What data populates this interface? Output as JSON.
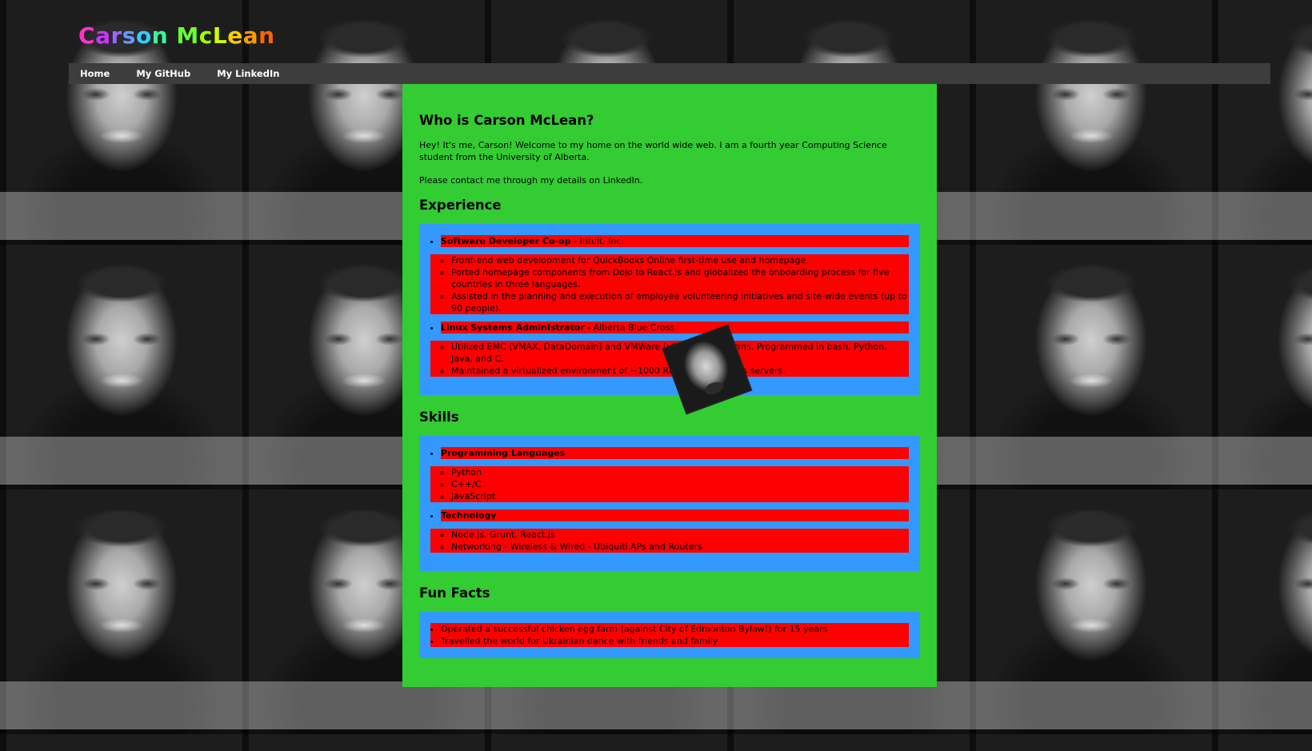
{
  "site": {
    "title_letters": [
      {
        "ch": "C",
        "color": "#ff33cc"
      },
      {
        "ch": "a",
        "color": "#cc33ff"
      },
      {
        "ch": "r",
        "color": "#9966ff"
      },
      {
        "ch": "s",
        "color": "#6699ff"
      },
      {
        "ch": "o",
        "color": "#33ccff"
      },
      {
        "ch": "n",
        "color": "#33ff99"
      },
      {
        "ch": " ",
        "color": "#000000"
      },
      {
        "ch": "M",
        "color": "#66ff33"
      },
      {
        "ch": "c",
        "color": "#99ff00"
      },
      {
        "ch": "L",
        "color": "#ccff00"
      },
      {
        "ch": "e",
        "color": "#ffcc00"
      },
      {
        "ch": "a",
        "color": "#ff9900"
      },
      {
        "ch": "n",
        "color": "#ff6600"
      }
    ]
  },
  "nav": {
    "home": "Home",
    "github": "My GitHub",
    "linkedin": "My LinkedIn"
  },
  "intro": {
    "heading": "Who is Carson McLean?",
    "para1": "Hey! It's me, Carson! Welcome to my home on the world wide web. I am a fourth year Computing Science student from the University of Alberta.",
    "para2": "Please contact me through my details on LinkedIn."
  },
  "experience": {
    "heading": "Experience",
    "jobs": [
      {
        "title": "Software Developer Co-op",
        "org": " - Intuit, Inc.",
        "items": [
          "Front-end web development for QuickBooks Online first-time use and homepage.",
          "Ported homepage components from Dojo to React.js and globalized the onboarding process for five countries in three languages.",
          "Assisted in the planning and execution of employee volunteering initiatives and site-wide events (up to 90 people)."
        ]
      },
      {
        "title": "Linux Systems Administrator",
        "org": " - Alberta Blue Cross",
        "items": [
          "Utilized EMC (VMAX, DataDomain) and VMWare (vSphere) platforms. Programmed in bash, Python, Java, and C.",
          "Maintained a virtualized environment of ~1000 RHEL and Windows servers."
        ]
      }
    ]
  },
  "skills": {
    "heading": "Skills",
    "groups": [
      {
        "title": "Programming Languages",
        "items": [
          "Python",
          "C++/C",
          "JavaScript"
        ]
      },
      {
        "title": "Technology",
        "items": [
          "Node.js, Grunt, React.js",
          "Networking - Wireless & Wired - Ubiquiti APs and Routers"
        ]
      }
    ]
  },
  "fun": {
    "heading": "Fun Facts",
    "items": [
      "Operated a successful chicken egg farm (against City of Edmonton Bylaw!) for 15 years",
      "Travelled the world for Ukrainian dance with friends and family"
    ]
  }
}
